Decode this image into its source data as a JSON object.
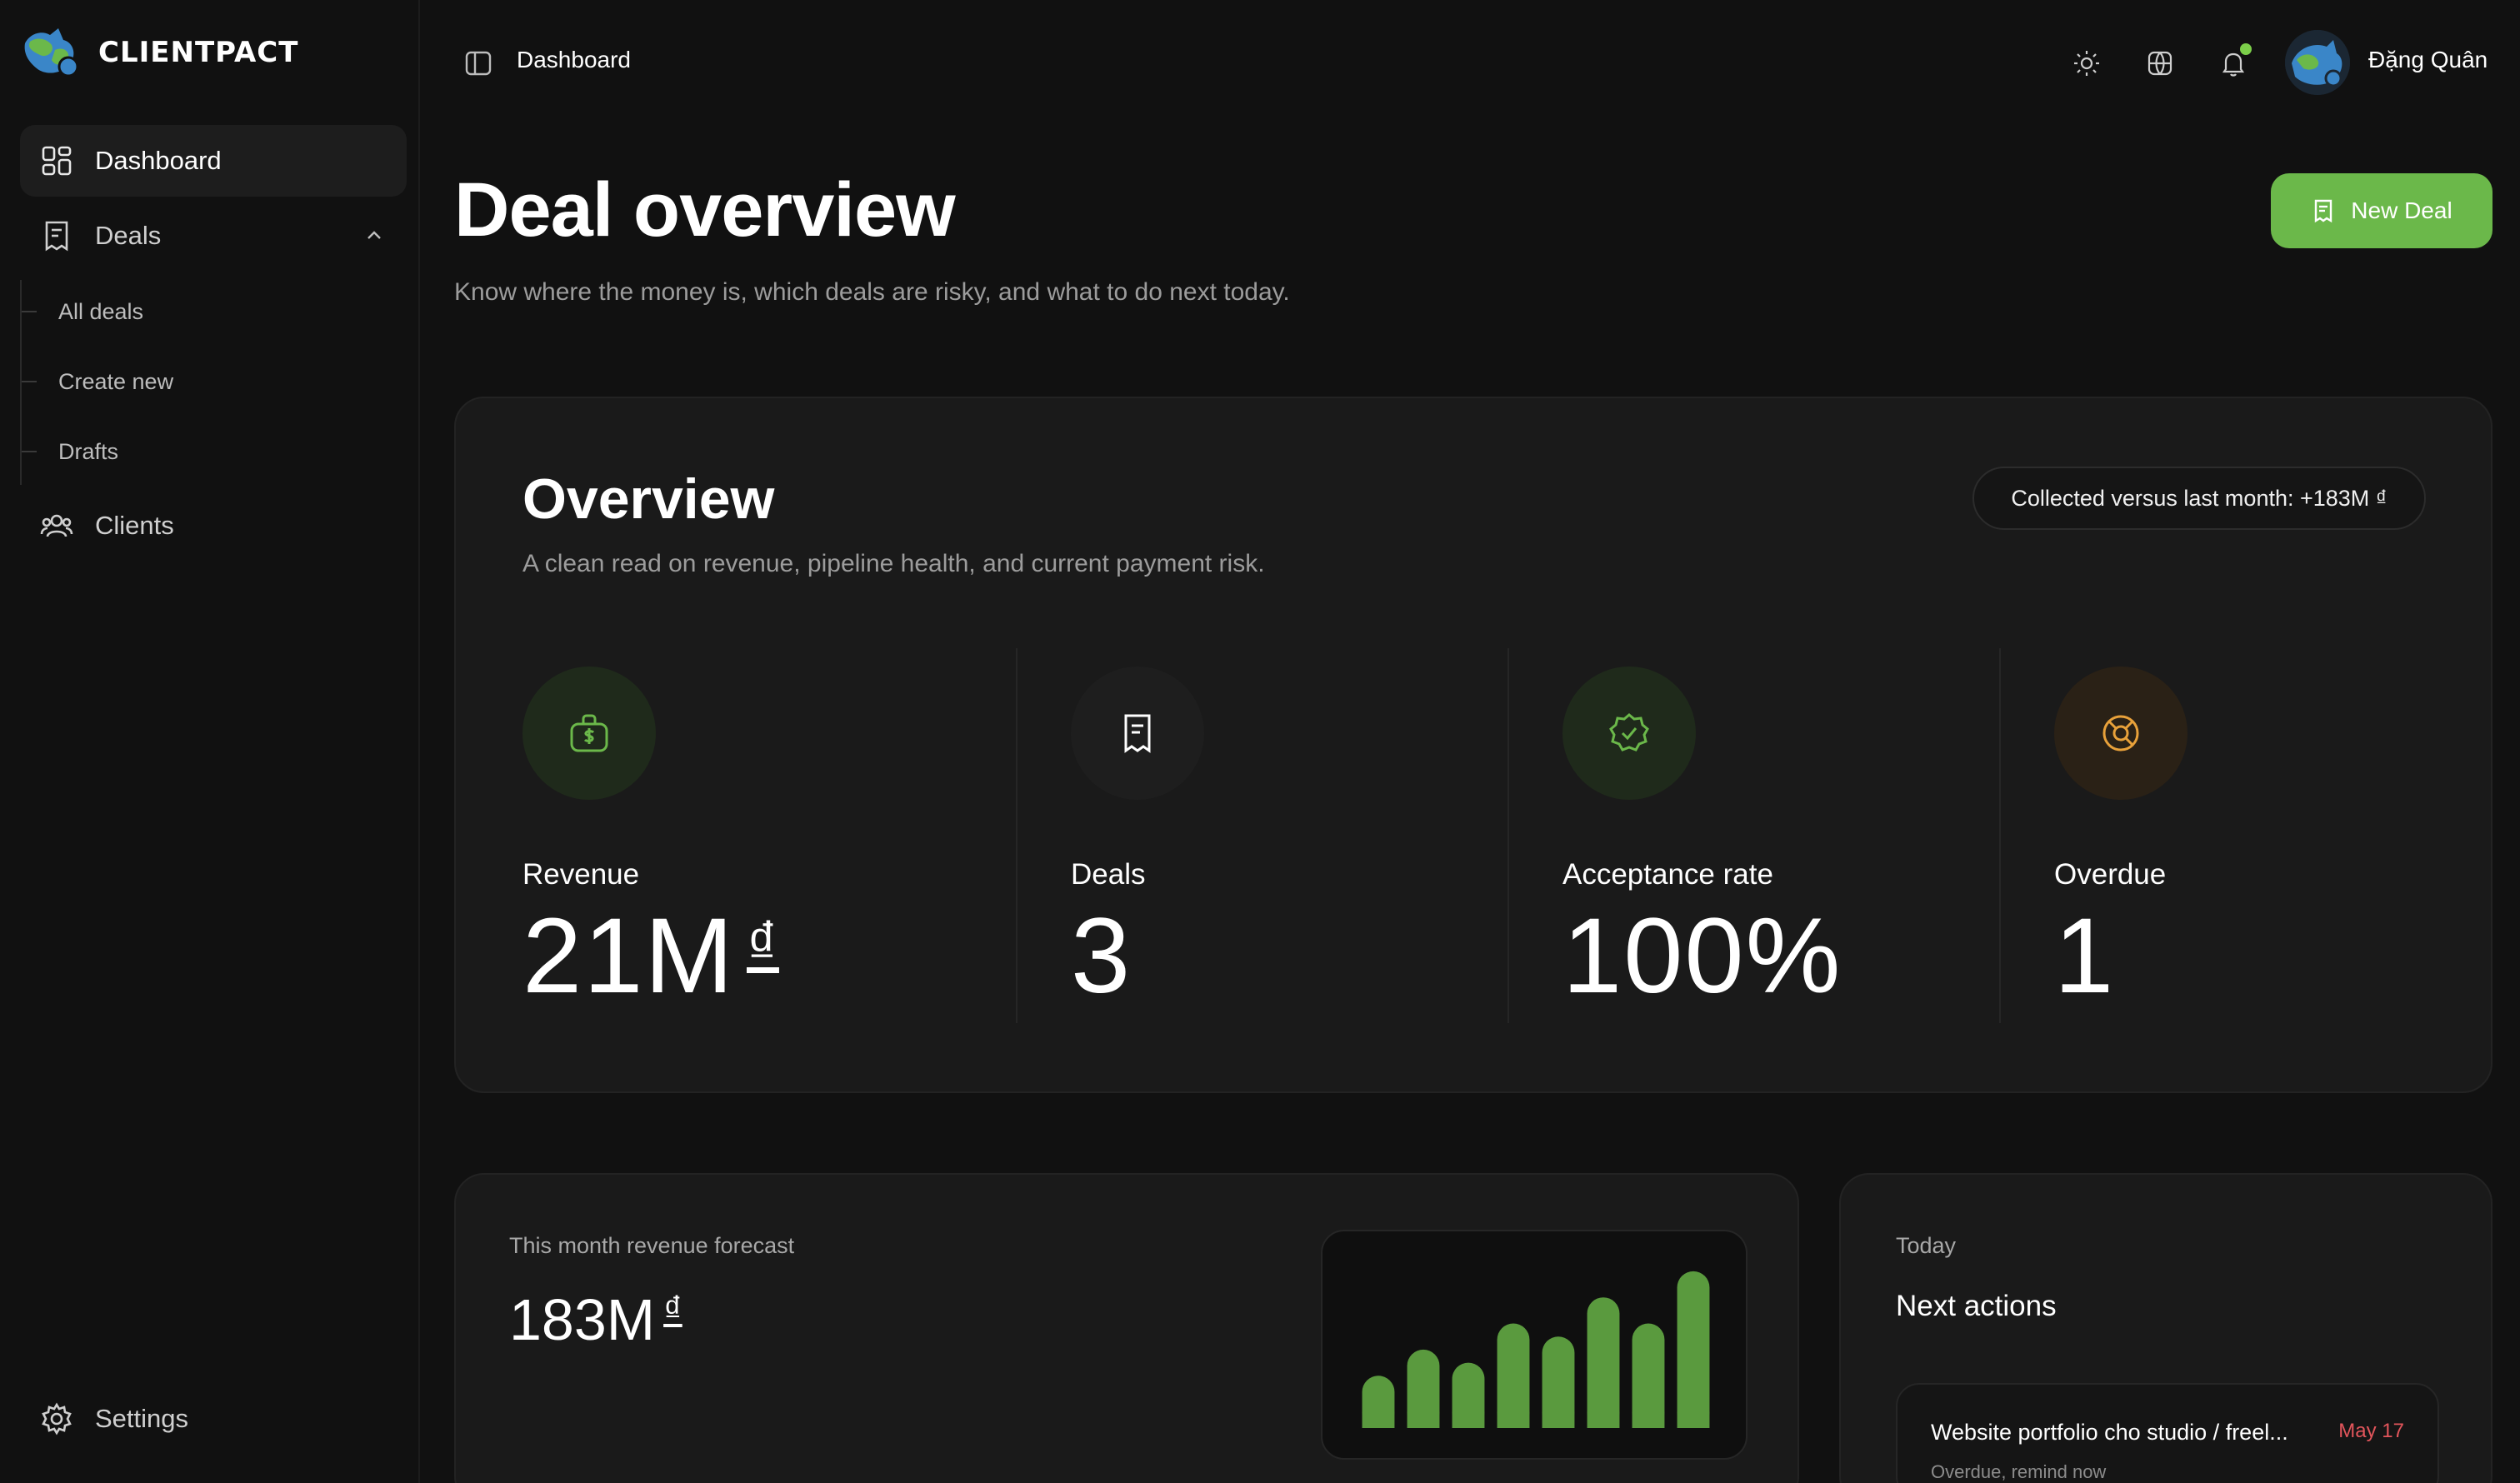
{
  "app": {
    "logo_text": "CLIENTPACT"
  },
  "sidebar": {
    "items": [
      {
        "label": "Dashboard",
        "icon": "dashboard-grid-icon",
        "active": true
      },
      {
        "label": "Deals",
        "icon": "receipt-icon",
        "expanded": true
      },
      {
        "label": "Clients",
        "icon": "users-icon"
      }
    ],
    "deals_subitems": [
      "All deals",
      "Create new",
      "Drafts"
    ],
    "settings_label": "Settings"
  },
  "header": {
    "breadcrumb": "Dashboard",
    "icons": [
      "sun-icon",
      "globe-icon",
      "bell-icon"
    ],
    "user_name": "Đặng Quân"
  },
  "page": {
    "title": "Deal overview",
    "subtitle": "Know where the money is, which deals are risky, and what to do next today.",
    "new_deal_label": "New Deal"
  },
  "overview": {
    "title": "Overview",
    "subtitle": "A clean read on revenue, pipeline health, and current payment risk.",
    "comparison_pill": "Collected versus last month: +183M ₫",
    "metrics": [
      {
        "label": "Revenue",
        "value": "21M",
        "currency": "₫",
        "icon": "money-bag-icon",
        "color": "#6bb84a"
      },
      {
        "label": "Deals",
        "value": "3",
        "icon": "receipt-icon",
        "color": "#ffffff"
      },
      {
        "label": "Acceptance rate",
        "value": "100%",
        "icon": "verified-badge-icon",
        "color": "#6bb84a"
      },
      {
        "label": "Overdue",
        "value": "1",
        "icon": "lifebuoy-icon",
        "color": "#e8a13a"
      }
    ]
  },
  "forecast": {
    "label": "This month revenue forecast",
    "value": "183M",
    "currency": "₫"
  },
  "chart_data": {
    "type": "bar",
    "values": [
      32,
      48,
      40,
      64,
      56,
      80,
      64,
      96
    ],
    "ylim": [
      0,
      100
    ],
    "color": "#5a9a3e"
  },
  "next_actions": {
    "label": "Today",
    "title": "Next actions",
    "items": [
      {
        "name": "Website portfolio cho studio / freel...",
        "date": "May 17",
        "status": "Overdue, remind now"
      }
    ]
  },
  "colors": {
    "accent": "#6bb84a",
    "warning": "#e8a13a",
    "danger": "#e2555b",
    "background": "#111111",
    "card": "#1a1a1a"
  }
}
